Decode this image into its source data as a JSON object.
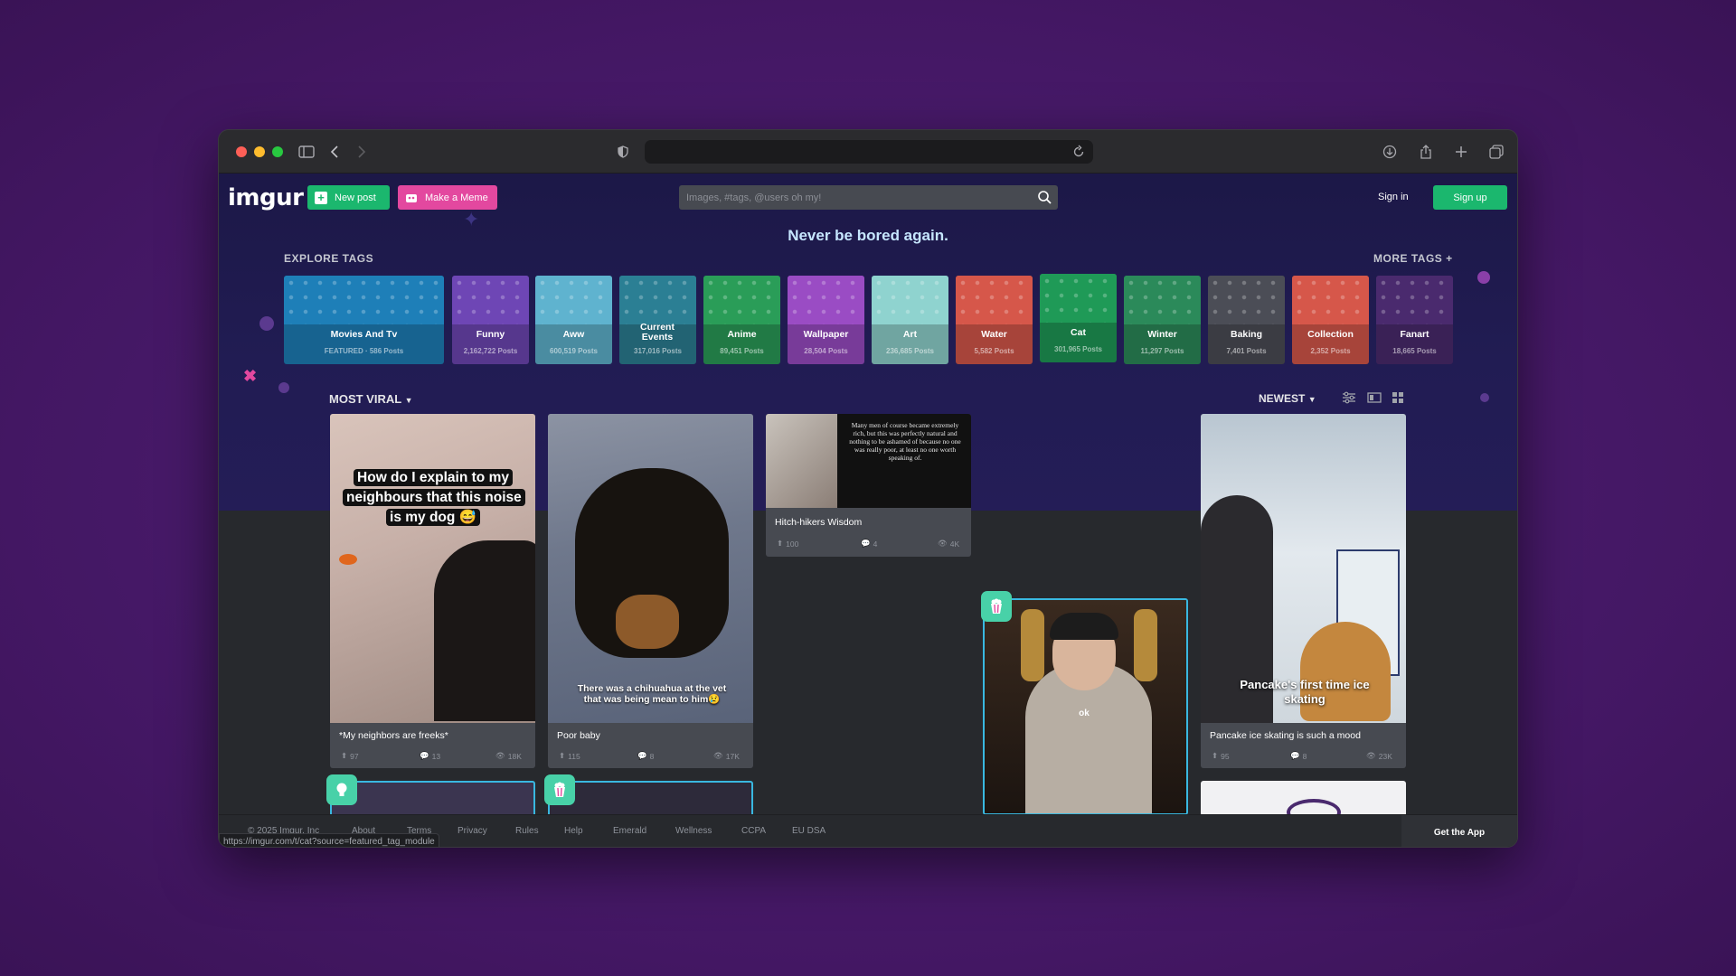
{
  "browser": {
    "url": ""
  },
  "nav": {
    "logo": "imgur",
    "new_post": "New post",
    "make_meme": "Make a Meme",
    "search_placeholder": "Images, #tags, @users oh my!",
    "sign_in": "Sign in",
    "sign_up": "Sign up"
  },
  "hero": {
    "tagline": "Never be bored again."
  },
  "explore": {
    "label": "EXPLORE TAGS",
    "more": "MORE TAGS +",
    "tags": [
      {
        "name": "Movies And Tv",
        "count": "FEATURED · 586 Posts",
        "color": "#1e7fb8"
      },
      {
        "name": "Funny",
        "count": "2,162,722 Posts",
        "color": "#6e46b5"
      },
      {
        "name": "Aww",
        "count": "600,519 Posts",
        "color": "#5fb3cf"
      },
      {
        "name": "Current Events",
        "count": "317,016 Posts",
        "color": "#2b7f94"
      },
      {
        "name": "Anime",
        "count": "89,451 Posts",
        "color": "#2a9d58"
      },
      {
        "name": "Wallpaper",
        "count": "28,504 Posts",
        "color": "#9a4cc4"
      },
      {
        "name": "Art",
        "count": "236,685 Posts",
        "color": "#8fd3cf"
      },
      {
        "name": "Water",
        "count": "5,582 Posts",
        "color": "#d6574a"
      },
      {
        "name": "Cat",
        "count": "301,965 Posts",
        "color": "#1f9a57"
      },
      {
        "name": "Winter",
        "count": "11,297 Posts",
        "color": "#2b8a5a"
      },
      {
        "name": "Baking",
        "count": "7,401 Posts",
        "color": "#4b4d56"
      },
      {
        "name": "Collection",
        "count": "2,352 Posts",
        "color": "#d6574a"
      },
      {
        "name": "Fanart",
        "count": "18,665 Posts",
        "color": "#4a2a6e"
      }
    ]
  },
  "feed": {
    "sort_label": "MOST VIRAL",
    "order_label": "NEWEST",
    "posts": [
      {
        "title": "*My neighbors are freeks*",
        "caption": "How do I explain to my neighbours that this noise is my dog 😅",
        "up": "97",
        "comments": "13",
        "views": "18K"
      },
      {
        "title": "Poor baby",
        "caption": "There was a chihuahua at the vet that was being mean to him😢",
        "up": "115",
        "comments": "8",
        "views": "17K"
      },
      {
        "title": "Hitch-hikers Wisdom",
        "caption": "Many men of course became extremely rich, but this was perfectly natural and nothing to be ashamed of because no one was really poor, at least no one worth speaking of.",
        "up": "100",
        "comments": "4",
        "views": "4K"
      },
      {
        "title": "Pancake ice skating is such a mood",
        "caption": "Pancake's first time ice skating",
        "up": "95",
        "comments": "8",
        "views": "23K"
      },
      {
        "title": "",
        "caption": "ok",
        "up": "",
        "comments": "",
        "views": ""
      }
    ]
  },
  "footer": {
    "copyright": "© 2025 Imgur, Inc",
    "links": [
      "About",
      "Terms",
      "Privacy",
      "Rules",
      "Help",
      "Emerald",
      "Wellness",
      "CCPA",
      "EU DSA"
    ],
    "get_app": "Get the App",
    "status_url": "https://imgur.com/t/cat?source=featured_tag_module"
  }
}
